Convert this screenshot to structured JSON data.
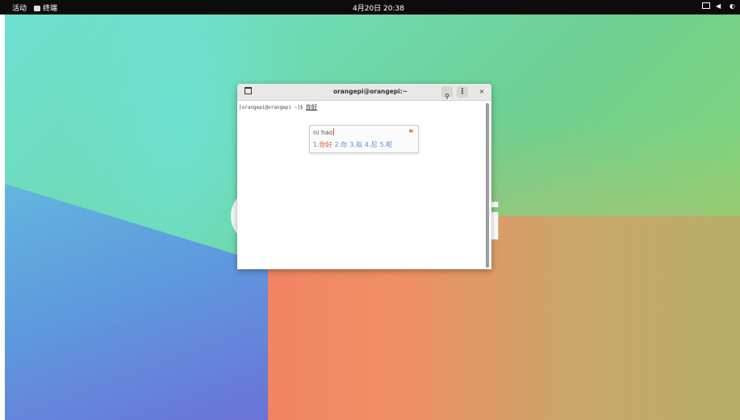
{
  "topbar": {
    "activities_label": "活动",
    "app_label": "终端",
    "clock": "4月20日 20:38",
    "tray_icons": [
      "network-icon",
      "volume-icon",
      "power-icon"
    ]
  },
  "wallpaper": {
    "logo_text": "i",
    "colors": {
      "teal": "#6ee0d0",
      "green": "#7fd57a",
      "blue": "#5e9ade",
      "orange": "#f28464",
      "olive": "#b8ad6a"
    }
  },
  "terminal": {
    "title": "orangepi@orangepi:~",
    "prompt": "[orangepi@orangepi ~]$ ",
    "typed_text": "你好",
    "newtab_icon": "new-tab-icon",
    "search_icon": "search-icon",
    "menu_label": "⋮",
    "close_label": "×"
  },
  "ime": {
    "preedit": "ni hao",
    "logo": "◖▸",
    "candidates": [
      {
        "index": "1.",
        "text": "你好",
        "selected": true
      },
      {
        "index": "2.",
        "text": "你",
        "selected": false
      },
      {
        "index": "3.",
        "text": "拟",
        "selected": false
      },
      {
        "index": "4.",
        "text": "尼",
        "selected": false
      },
      {
        "index": "5.",
        "text": "呢",
        "selected": false
      }
    ],
    "colors": {
      "selected": "#e2572b",
      "normal": "#5b8fcf"
    }
  }
}
